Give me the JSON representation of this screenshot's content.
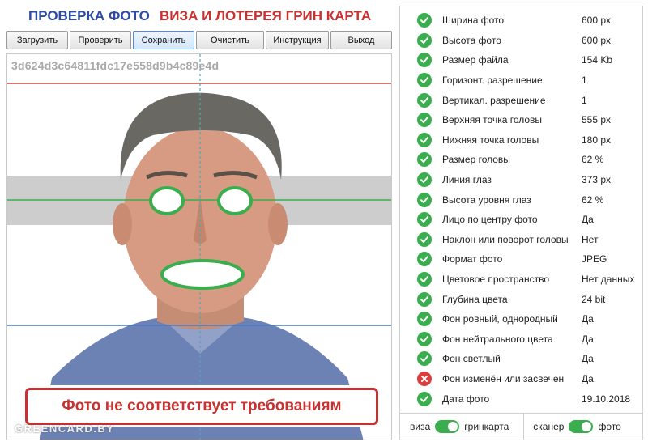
{
  "header": {
    "title_left": "ПРОВЕРКА ФОТО",
    "title_right": "ВИЗА И ЛОТЕРЕЯ ГРИН КАРТА"
  },
  "toolbar": {
    "buttons": [
      {
        "label": "Загрузить"
      },
      {
        "label": "Проверить"
      },
      {
        "label": "Сохранить"
      },
      {
        "label": "Очистить"
      },
      {
        "label": "Инструкция"
      },
      {
        "label": "Выход"
      }
    ]
  },
  "photo": {
    "hash": "3d624d3c64811fdc17e558d9b4c89e4d",
    "error_message": "Фото не соответствует требованиям",
    "watermark": "GREENCARD.BY"
  },
  "checks": [
    {
      "label": "Ширина фото",
      "value": "600 px",
      "status": "ok"
    },
    {
      "label": "Высота фото",
      "value": "600 px",
      "status": "ok"
    },
    {
      "label": "Размер файла",
      "value": "154 Kb",
      "status": "ok"
    },
    {
      "label": "Горизонт. разрешение",
      "value": "1",
      "status": "ok"
    },
    {
      "label": "Вертикал. разрешение",
      "value": "1",
      "status": "ok"
    },
    {
      "label": "Верхняя точка головы",
      "value": "555 px",
      "status": "ok"
    },
    {
      "label": "Нижняя точка головы",
      "value": "180 px",
      "status": "ok"
    },
    {
      "label": "Размер головы",
      "value": "62 %",
      "status": "ok"
    },
    {
      "label": "Линия глаз",
      "value": "373 px",
      "status": "ok"
    },
    {
      "label": "Высота уровня глаз",
      "value": "62 %",
      "status": "ok"
    },
    {
      "label": "Лицо по центру фото",
      "value": "Да",
      "status": "ok"
    },
    {
      "label": "Наклон или поворот головы",
      "value": "Нет",
      "status": "ok"
    },
    {
      "label": "Формат фото",
      "value": "JPEG",
      "status": "ok"
    },
    {
      "label": "Цветовое пространство",
      "value": "Нет данных",
      "status": "ok"
    },
    {
      "label": "Глубина цвета",
      "value": "24 bit",
      "status": "ok"
    },
    {
      "label": "Фон ровный, однородный",
      "value": "Да",
      "status": "ok"
    },
    {
      "label": "Фон нейтрального цвета",
      "value": "Да",
      "status": "ok"
    },
    {
      "label": "Фон светлый",
      "value": "Да",
      "status": "ok"
    },
    {
      "label": "Фон изменён или засвечен",
      "value": "Да",
      "status": "fail"
    },
    {
      "label": "Дата фото",
      "value": "19.10.2018",
      "status": "ok"
    }
  ],
  "footer": {
    "toggle1_left": "виза",
    "toggle1_right": "гринкарта",
    "toggle2_left": "сканер",
    "toggle2_right": "фото"
  },
  "colors": {
    "ok": "#3aad4e",
    "fail": "#dc3d3d",
    "title_blue": "#2d4aa6",
    "title_red": "#c8312f"
  }
}
